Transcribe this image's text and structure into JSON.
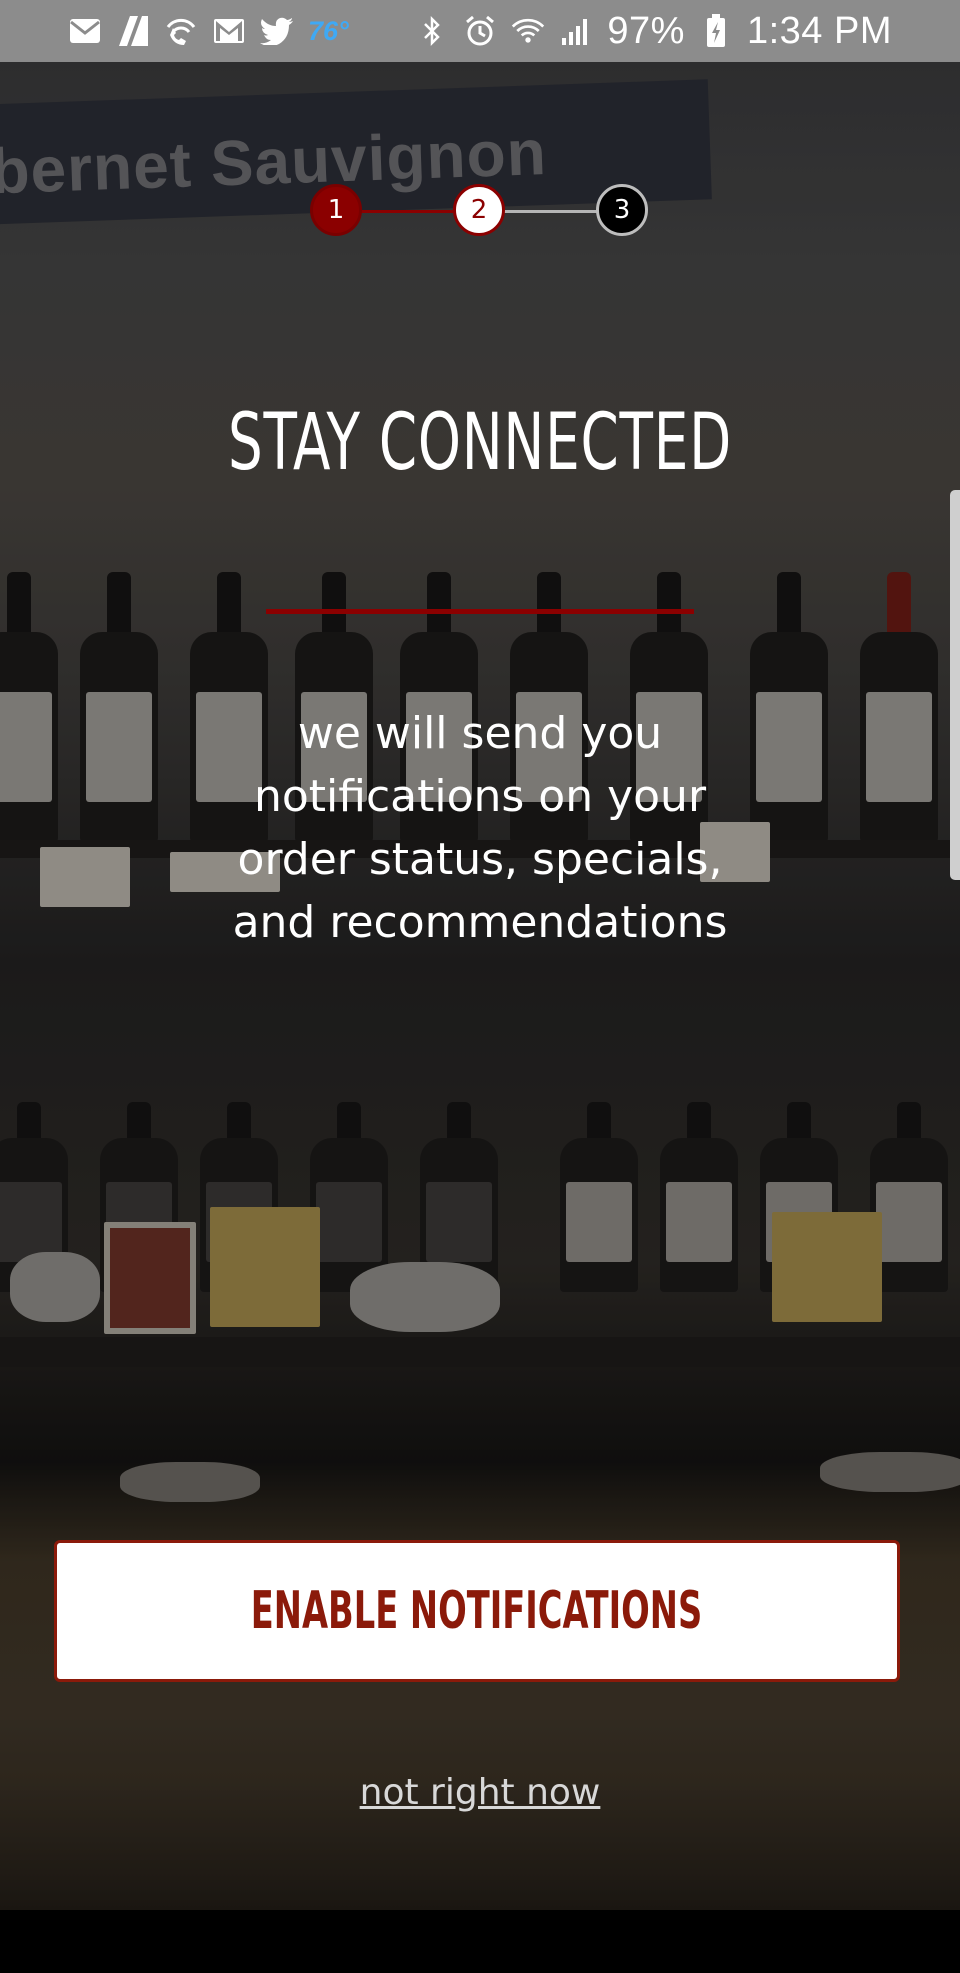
{
  "status_bar": {
    "temperature": "76°",
    "battery": "97%",
    "time": "1:34 PM",
    "left_icons": [
      "mail-icon",
      "flipboard-icon",
      "wifi-call-icon",
      "gmail-icon",
      "twitter-icon"
    ],
    "right_icons": [
      "bluetooth-icon",
      "alarm-icon",
      "wifi-icon",
      "signal-icon",
      "battery-charging-icon"
    ]
  },
  "background": {
    "sign_text": "bernet Sauvignon"
  },
  "stepper": {
    "steps": [
      "1",
      "2",
      "3"
    ],
    "current_step": 2,
    "colors": {
      "active": "#8b0000",
      "inactive": "#bdbdbd"
    }
  },
  "content": {
    "title": "STAY CONNECTED",
    "body": "we will send you notifications on your order status, specials, and recommendations"
  },
  "actions": {
    "enable_label": "ENABLE NOTIFICATIONS",
    "skip_label": "not right now"
  },
  "colors": {
    "accent": "#8b0000",
    "button_text": "#8b1a0a"
  }
}
